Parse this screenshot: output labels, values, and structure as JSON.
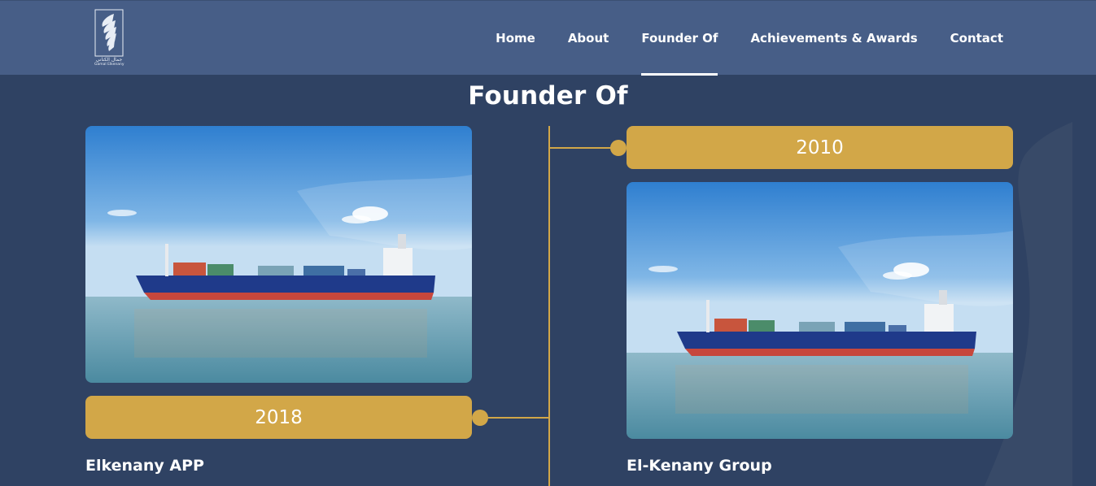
{
  "logo": {
    "icon": "feather-logo-icon",
    "arabic_text": "جمال الكناني",
    "english_text": "Gamal Elkenany"
  },
  "nav": {
    "items": [
      {
        "label": "Home",
        "active": false
      },
      {
        "label": "About",
        "active": false
      },
      {
        "label": "Founder Of",
        "active": true
      },
      {
        "label": "Achievements & Awards",
        "active": false
      },
      {
        "label": "Contact",
        "active": false
      }
    ]
  },
  "section": {
    "title": "Founder Of"
  },
  "timeline": {
    "entries": [
      {
        "year": "2018",
        "name": "Elkenany APP",
        "image": "cargo-ship-image"
      },
      {
        "year": "2010",
        "name": "El-Kenany Group",
        "image": "cargo-ship-image"
      }
    ]
  },
  "colors": {
    "background": "#2f4263",
    "header": "#475e87",
    "accent_gold": "#d2a748"
  }
}
